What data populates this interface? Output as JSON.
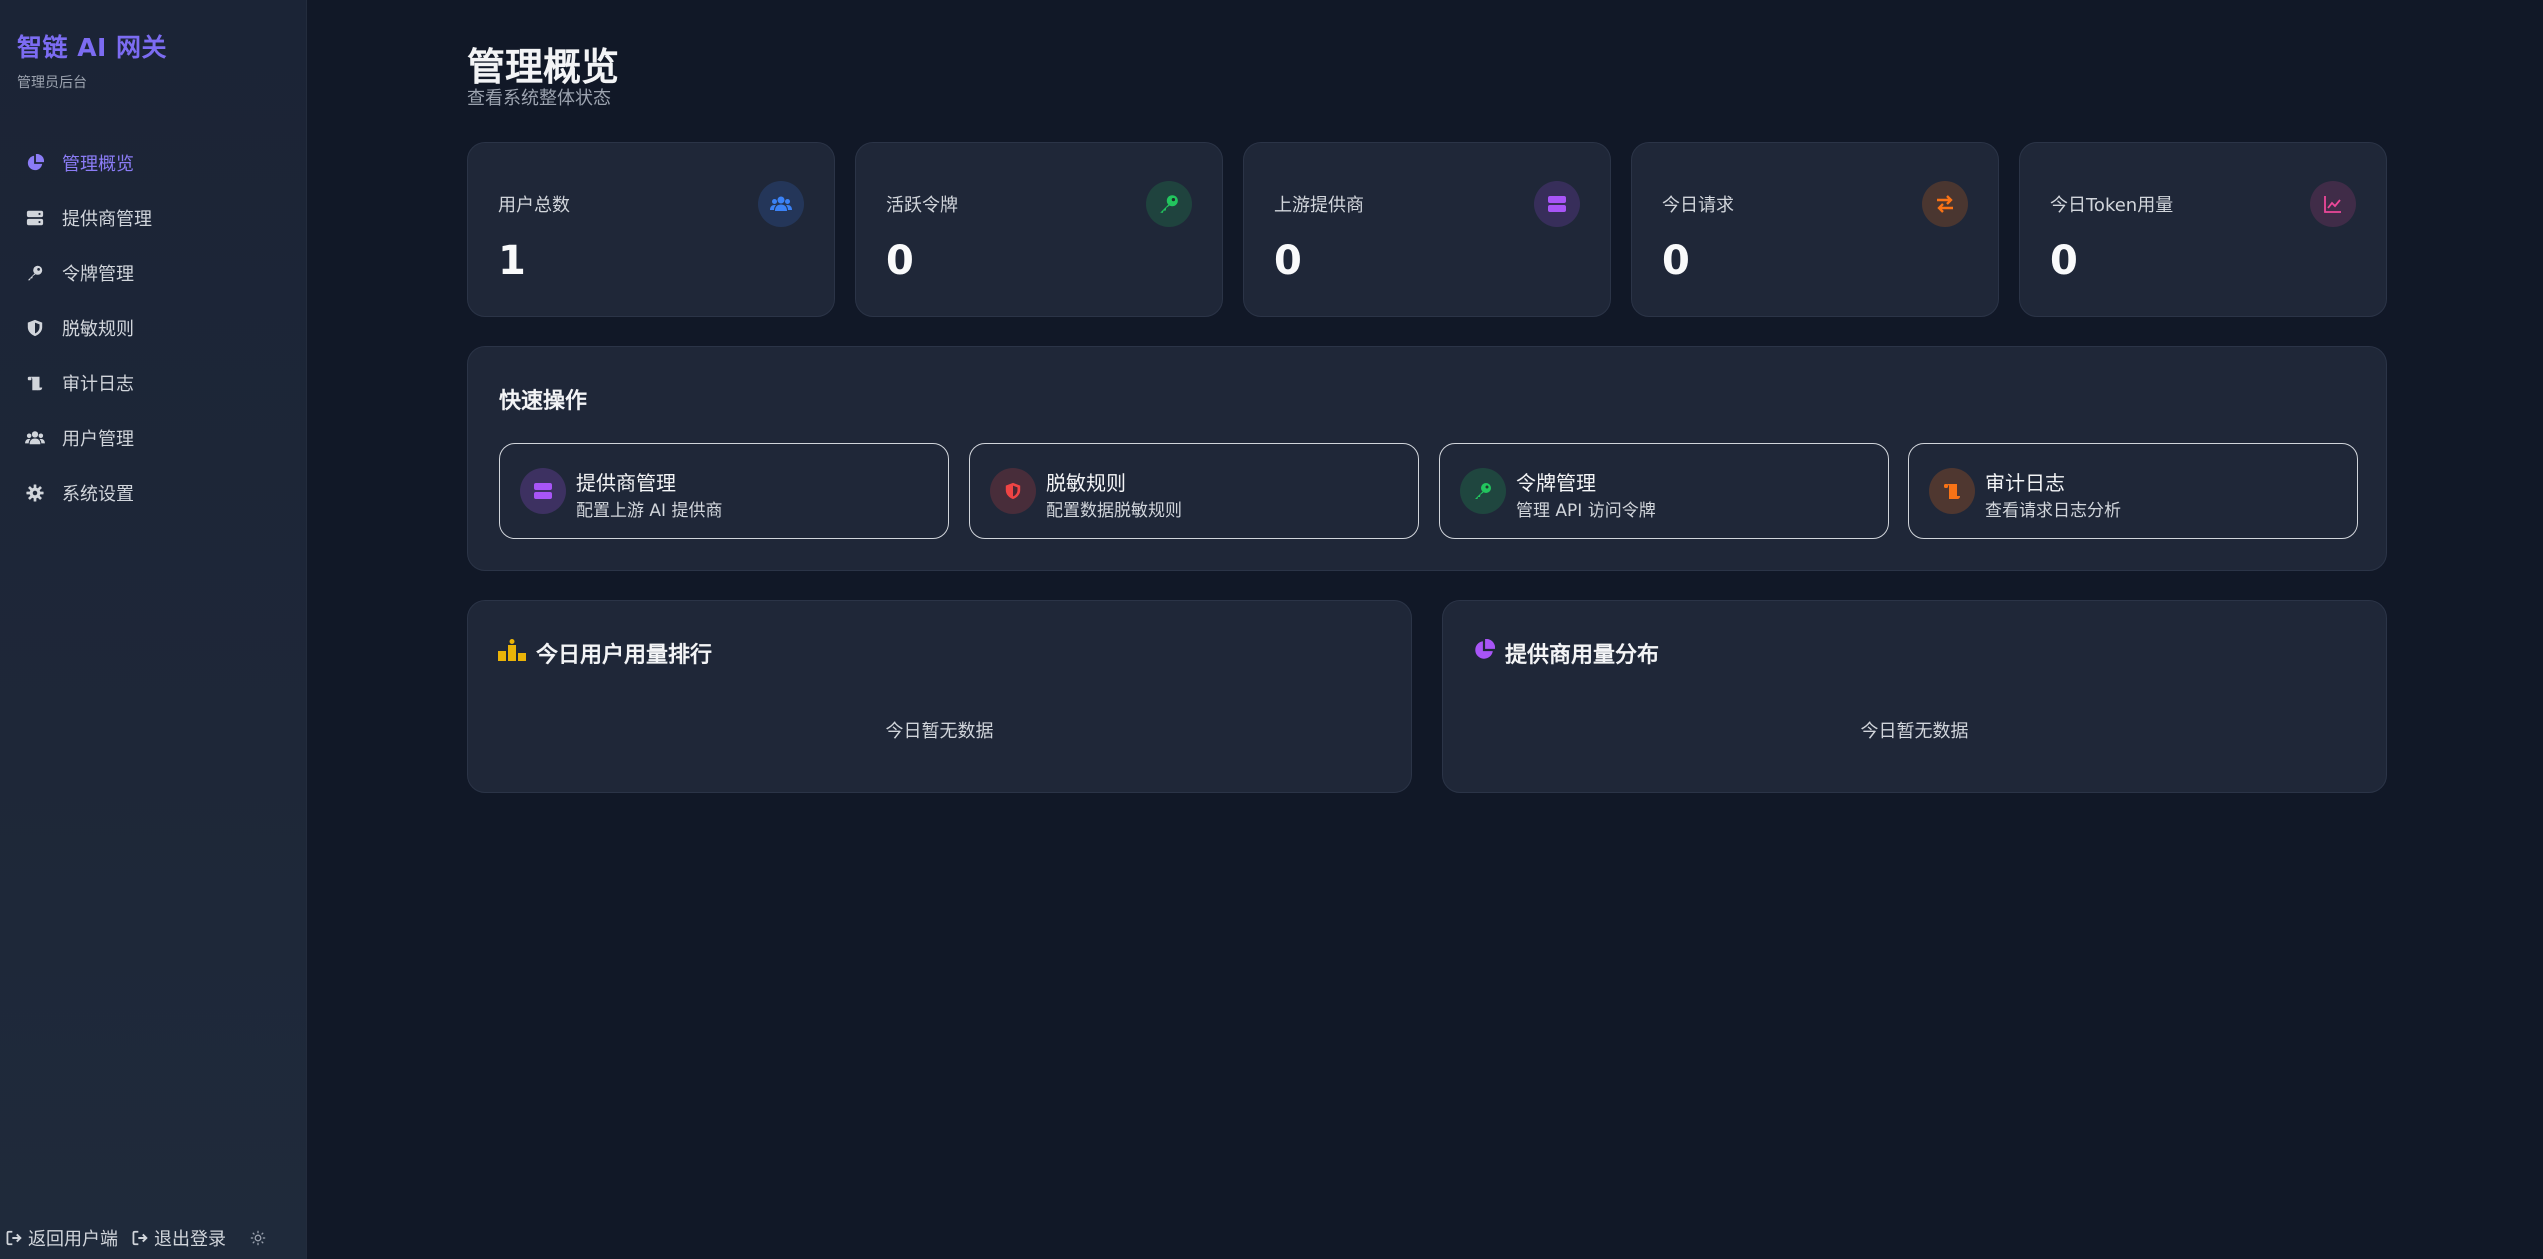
{
  "brand": {
    "title": "智链 AI 网关",
    "subtitle": "管理员后台"
  },
  "sidebar": {
    "items": [
      {
        "label": "管理概览",
        "icon": "pie-chart-icon",
        "active": true
      },
      {
        "label": "提供商管理",
        "icon": "server-icon"
      },
      {
        "label": "令牌管理",
        "icon": "key-icon"
      },
      {
        "label": "脱敏规则",
        "icon": "shield-icon"
      },
      {
        "label": "审计日志",
        "icon": "scroll-icon"
      },
      {
        "label": "用户管理",
        "icon": "users-icon"
      },
      {
        "label": "系统设置",
        "icon": "gear-icon"
      }
    ],
    "footer": {
      "back_label": "返回用户端",
      "logout_label": "退出登录",
      "theme_icon": "sun-icon"
    }
  },
  "header": {
    "title": "管理概览",
    "subtitle": "查看系统整体状态"
  },
  "stats": [
    {
      "label": "用户总数",
      "value": "1",
      "icon": "users-icon",
      "color": "#3b82f6"
    },
    {
      "label": "活跃令牌",
      "value": "0",
      "icon": "key-icon",
      "color": "#22c55e"
    },
    {
      "label": "上游提供商",
      "value": "0",
      "icon": "server-icon",
      "color": "#a855f7"
    },
    {
      "label": "今日请求",
      "value": "0",
      "icon": "exchange-icon",
      "color": "#f97316"
    },
    {
      "label": "今日Token用量",
      "value": "0",
      "icon": "line-chart-icon",
      "color": "#ec4899"
    }
  ],
  "quick_actions": {
    "title": "快速操作",
    "items": [
      {
        "title": "提供商管理",
        "desc": "配置上游 AI 提供商",
        "icon": "server-icon",
        "color": "#a855f7"
      },
      {
        "title": "脱敏规则",
        "desc": "配置数据脱敏规则",
        "icon": "shield-icon",
        "color": "#ef4444"
      },
      {
        "title": "令牌管理",
        "desc": "管理 API 访问令牌",
        "icon": "key-icon",
        "color": "#22c55e"
      },
      {
        "title": "审计日志",
        "desc": "查看请求日志分析",
        "icon": "scroll-icon",
        "color": "#f97316"
      }
    ]
  },
  "ranking": {
    "title": "今日用户用量排行",
    "empty": "今日暂无数据",
    "icon": "ranking-icon",
    "color": "#eab308"
  },
  "distribution": {
    "title": "提供商用量分布",
    "empty": "今日暂无数据",
    "icon": "pie-chart-icon",
    "color": "#a855f7"
  },
  "colors": {
    "accent": "#7c6cf2",
    "background": "#111827",
    "card": "#1f2738"
  }
}
